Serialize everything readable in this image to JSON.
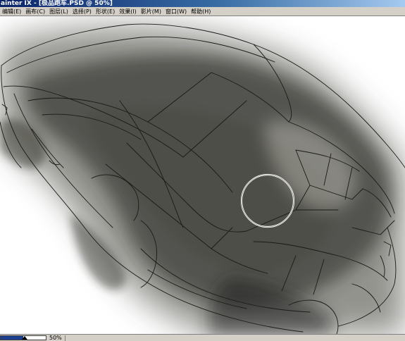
{
  "window": {
    "title": "ainter IX - [极品跑车.PSD @ 50%]"
  },
  "menu": [
    {
      "id": "edit",
      "label": "编辑(E)"
    },
    {
      "id": "canvas",
      "label": "画布(C)"
    },
    {
      "id": "layers",
      "label": "图层(L)"
    },
    {
      "id": "select",
      "label": "选择(P)"
    },
    {
      "id": "shape",
      "label": "形状(E)"
    },
    {
      "id": "effects",
      "label": "效果(I)"
    },
    {
      "id": "movie",
      "label": "影片(M)"
    },
    {
      "id": "window",
      "label": "窗口(W)"
    },
    {
      "id": "help",
      "label": "帮助(H)"
    }
  ],
  "canvas": {
    "content": "car sketch with airbrushed shading",
    "brush_cursor": "circle-brush-cursor",
    "ink_color": "#1a1a16",
    "shade_color": "#3b3a33"
  },
  "status": {
    "zoom": "50%",
    "zoom_fraction": 0.5
  }
}
